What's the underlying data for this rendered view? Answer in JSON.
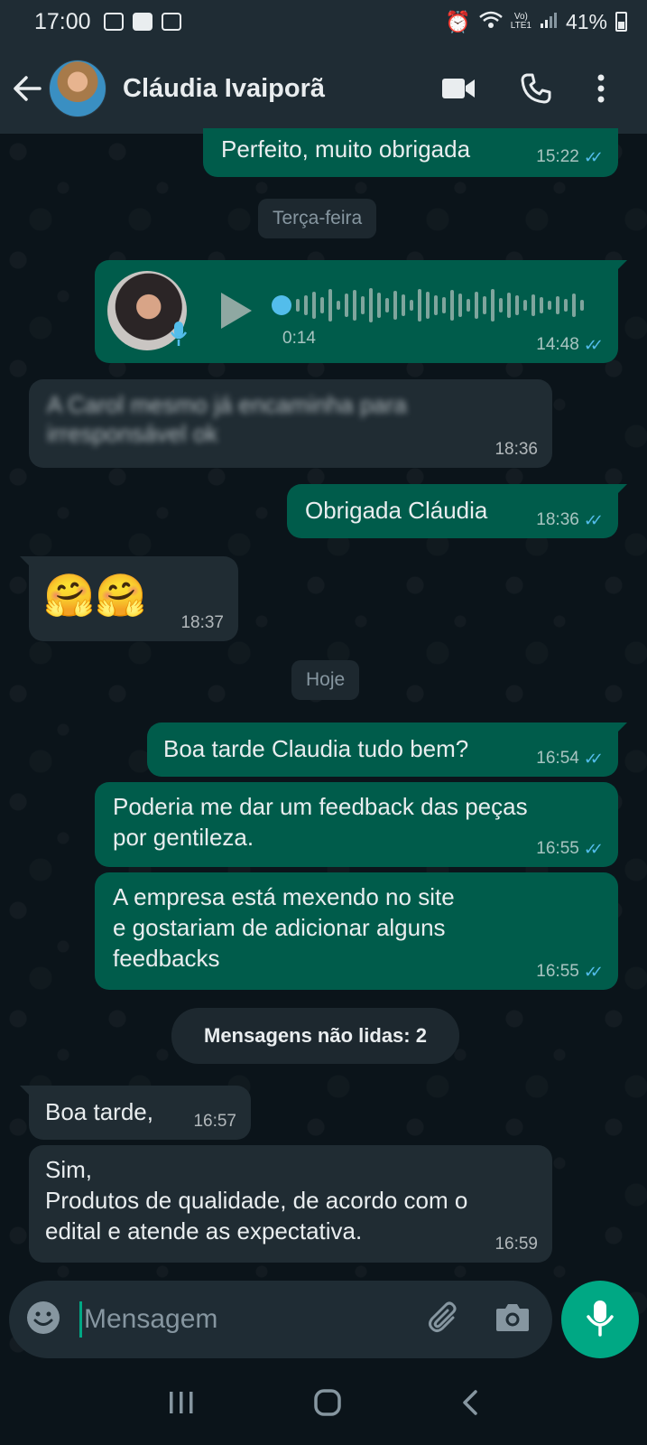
{
  "status_bar": {
    "time": "17:00",
    "battery": "41%",
    "network_label_top": "Vo)",
    "network_label_bottom": "LTE1"
  },
  "header": {
    "contact_name": "Cláudia Ivaiporã",
    "icons": [
      "back-arrow-icon",
      "video-call-icon",
      "phone-icon",
      "more-vert-icon"
    ]
  },
  "messages": [
    {
      "dir": "out",
      "text": "Perfeito, muito obrigada",
      "time": "15:22",
      "status": "read"
    },
    {
      "type": "date",
      "text": "Terça-feira"
    },
    {
      "dir": "out",
      "type": "voice",
      "duration": "0:14",
      "time": "14:48",
      "status": "read"
    },
    {
      "dir": "in",
      "text": "A Carol mesmo já encaminha para irresponsável ok",
      "time": "18:36",
      "blurred": true
    },
    {
      "dir": "out",
      "text": "Obrigada Cláudia",
      "time": "18:36",
      "status": "read"
    },
    {
      "dir": "in",
      "text": "🤗🤗",
      "time": "18:37"
    },
    {
      "type": "date",
      "text": "Hoje"
    },
    {
      "dir": "out",
      "text": "Boa tarde Claudia tudo bem?",
      "time": "16:54",
      "status": "read"
    },
    {
      "dir": "out",
      "text": "Poderia me dar um feedback das peças por gentileza.",
      "time": "16:55",
      "status": "read"
    },
    {
      "dir": "out",
      "text": "A empresa está mexendo no site e gostariam de adicionar alguns feedbacks",
      "time": "16:55",
      "status": "read"
    },
    {
      "type": "unread",
      "text": "Mensagens não lidas: 2"
    },
    {
      "dir": "in",
      "text": "Boa tarde,",
      "time": "16:57"
    },
    {
      "dir": "in",
      "text": "Sim,\nProdutos de qualidade, de acordo  com o edital e atende as  expectativa.",
      "time": "16:59"
    }
  ],
  "m": {
    "m1_text": "Perfeito, muito obrigada",
    "m1_time": "15:22",
    "d1": "Terça-feira",
    "v_dur": "0:14",
    "v_time": "14:48",
    "m3_line1": "A Carol mesmo já encaminha para",
    "m3_line2": "irresponsável ok",
    "m3_time": "18:36",
    "m4_text": "Obrigada Cláudia",
    "m4_time": "18:36",
    "m5_text": "🤗🤗",
    "m5_time": "18:37",
    "d2": "Hoje",
    "m6_text": "Boa tarde Claudia tudo bem?",
    "m6_time": "16:54",
    "m7_line1": "Poderia me dar um feedback das peças",
    "m7_line2": "por gentileza.",
    "m7_time": "16:55",
    "m8_line1": "A empresa está mexendo no site",
    "m8_line2": "e gostariam de adicionar alguns",
    "m8_line3": "feedbacks",
    "m8_time": "16:55",
    "unread": "Mensagens não lidas: 2",
    "m9_text": "Boa tarde,",
    "m9_time": "16:57",
    "m10_line1": "Sim,",
    "m10_line2": "Produtos de qualidade, de acordo  com o",
    "m10_line3": "edital e atende as  expectativa.",
    "m10_time": "16:59"
  },
  "ticks": "✓✓",
  "composer": {
    "placeholder": "Mensagem",
    "icons": [
      "emoji-icon",
      "attach-icon",
      "camera-icon",
      "mic-icon"
    ]
  },
  "colors": {
    "outgoing_bubble": "#005c4b",
    "incoming_bubble": "#202c33",
    "background": "#0b141a",
    "header": "#1f2c34",
    "accent": "#00a884",
    "read_ticks": "#53bdeb"
  }
}
